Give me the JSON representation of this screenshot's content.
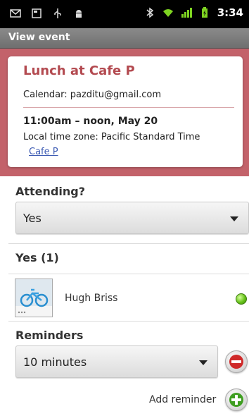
{
  "status_bar": {
    "left_icons": [
      "mail-icon",
      "window-icon",
      "usb-icon",
      "android-icon"
    ],
    "right_icons": [
      "bluetooth-icon",
      "wifi-icon",
      "signal-icon",
      "battery-icon"
    ],
    "time": "3:34"
  },
  "title_bar": {
    "title": "View event"
  },
  "event": {
    "title": "Lunch at Cafe P",
    "calendar": "Calendar:  pazditu@gmail.com",
    "time": "11:00am – noon, May 20",
    "timezone": "Local time zone:  Pacific Standard Time",
    "location": "Cafe P"
  },
  "attending": {
    "label": "Attending?",
    "value": "Yes"
  },
  "guests": {
    "header": "Yes (1)",
    "items": [
      {
        "name": "Hugh Briss",
        "status_color": "#66c21a"
      }
    ]
  },
  "reminders": {
    "label": "Reminders",
    "value": "10 minutes",
    "add_label": "Add reminder"
  },
  "colors": {
    "accent": "#c3626a",
    "title_color": "#b34a50",
    "link": "#3d5bb3",
    "remove": "#cf2a2a",
    "add": "#3f9e21"
  }
}
